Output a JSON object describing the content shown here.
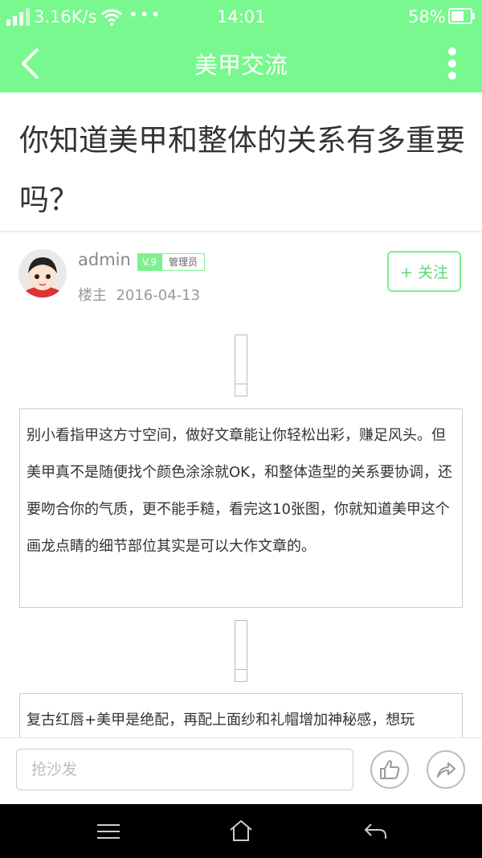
{
  "status_bar": {
    "network_speed": "3.16K/s",
    "time": "14:01",
    "battery": "58%"
  },
  "nav": {
    "title": "美甲交流"
  },
  "post": {
    "title": "你知道美甲和整体的关系有多重要吗？",
    "author": {
      "name": "admin",
      "level": "V.9",
      "role": "管理员",
      "floor": "楼主",
      "date": "2016-04-13"
    },
    "follow_label": "+ 关注",
    "paragraphs": [
      "别小看指甲这方寸空间，做好文章能让你轻松出彩，赚足风头。但美甲真不是随便找个颜色涂涂就OK，和整体造型的关系要协调，还要吻合你的气质，更不能手糙，看完这10张图，你就知道美甲这个画龙点睛的细节部位其实是可以大作文章的。",
      "复古红唇+美甲是绝配，再配上面纱和礼帽增加神秘感，想玩"
    ]
  },
  "comment": {
    "placeholder": "抢沙发"
  },
  "colors": {
    "accent": "#78f88e",
    "accent_border": "#7ef090"
  },
  "icons": [
    "back-arrow-icon",
    "more-vertical-icon",
    "thumb-up-icon",
    "share-icon",
    "menu-icon",
    "home-icon",
    "back-icon"
  ]
}
